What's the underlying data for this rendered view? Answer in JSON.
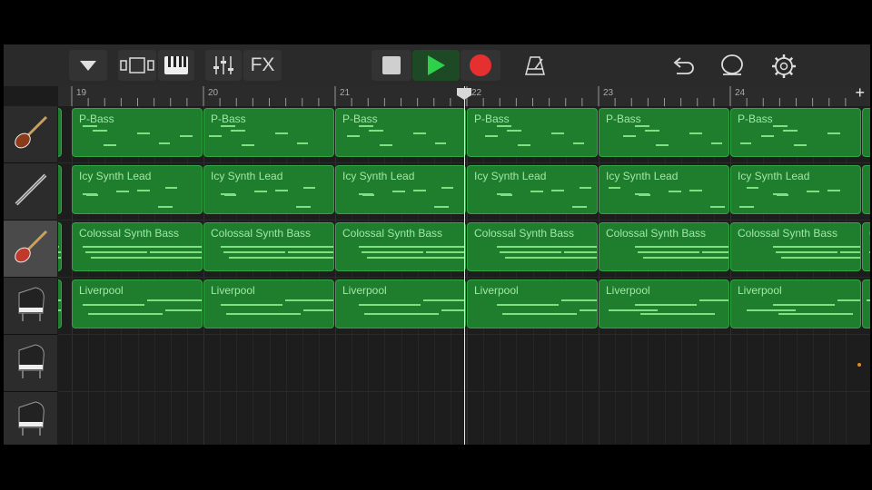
{
  "toolbar": {
    "fx_label": "FX",
    "buttons": [
      "browser-dropdown",
      "tracks-view",
      "keyboard",
      "mixer",
      "fx",
      "stop",
      "play",
      "record",
      "metronome",
      "undo",
      "loop-browser",
      "settings"
    ]
  },
  "ruler": {
    "bar_numbers": [
      "19",
      "20",
      "21",
      "22",
      "23",
      "24"
    ],
    "add_label": "+"
  },
  "colors": {
    "region_fill": "#1f7d2e",
    "region_border": "#2fa544",
    "note": "#7fe07f",
    "record": "#e63030",
    "play": "#2fd14a",
    "marker": "#e8891b"
  },
  "tracks": [
    {
      "instrument": "bass-guitar",
      "region_name": "P-Bass",
      "selected": false
    },
    {
      "instrument": "synth-lead",
      "region_name": "Icy Synth Lead",
      "selected": false
    },
    {
      "instrument": "bass-guitar-red",
      "region_name": "Colossal Synth Bass",
      "selected": true
    },
    {
      "instrument": "grand-piano",
      "region_name": "Liverpool",
      "selected": false
    },
    {
      "instrument": "grand-piano",
      "region_name": "",
      "selected": false
    },
    {
      "instrument": "grand-piano",
      "region_name": "",
      "selected": false
    }
  ]
}
